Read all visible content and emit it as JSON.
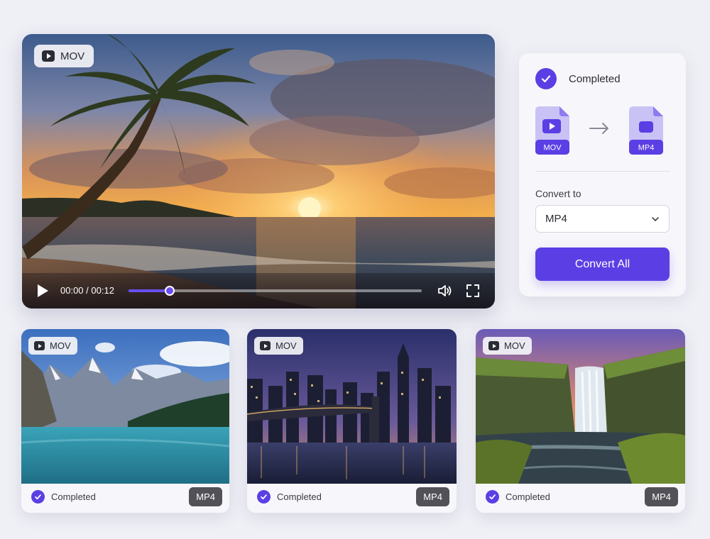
{
  "player": {
    "source_format": "MOV",
    "current_time": "00:00",
    "separator": "/",
    "duration": "00:12",
    "progress": 0.14,
    "accent": "#6a4ef0"
  },
  "panel": {
    "status": "Completed",
    "source_format": "MOV",
    "target_format": "MP4",
    "convert_to_label": "Convert to",
    "selected_format": "MP4",
    "convert_button": "Convert All",
    "accent": "#5b3fe4",
    "icons": [
      "check-icon",
      "video-file-icon",
      "arrow-right-icon",
      "video-file-icon",
      "chevron-down-icon"
    ]
  },
  "thumbnails": [
    {
      "scene": "mountain-lake",
      "source_format": "MOV",
      "output_format": "MP4",
      "status": "Completed"
    },
    {
      "scene": "city-skyline-bridge",
      "source_format": "MOV",
      "output_format": "MP4",
      "status": "Completed"
    },
    {
      "scene": "waterfall",
      "source_format": "MOV",
      "output_format": "MP4",
      "status": "Completed"
    }
  ]
}
